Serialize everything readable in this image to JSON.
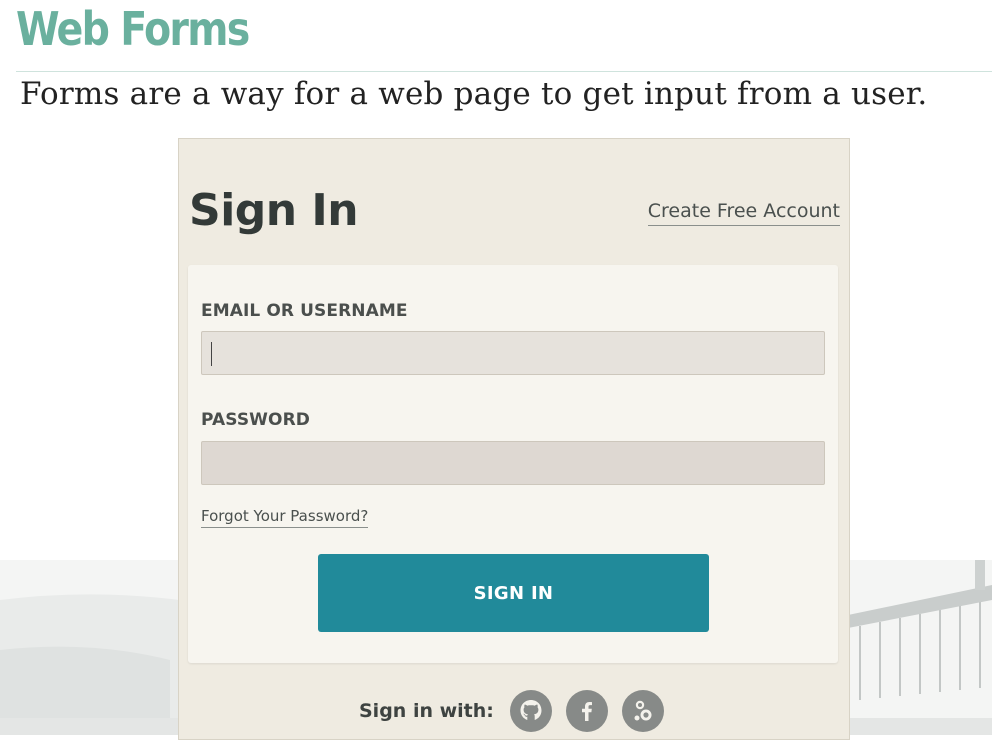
{
  "slide": {
    "title": "Web Forms",
    "subtitle": "Forms are a way for a web page to get input from a user."
  },
  "sign_in_card": {
    "heading": "Sign In",
    "create_account_link": "Create Free Account",
    "email_label": "EMAIL OR USERNAME",
    "email_value": "",
    "password_label": "PASSWORD",
    "password_value": "",
    "forgot_password_link": "Forgot Your Password?",
    "submit_label": "SIGN IN",
    "social_label": "Sign in with:",
    "social_icons": [
      "github-icon",
      "facebook-icon",
      "google-plus-icon"
    ]
  },
  "colors": {
    "title": "#6ab09e",
    "card_background": "#efebe1",
    "panel_background": "#f7f5ef",
    "button": "#218a9a",
    "social_icon": "#878a88"
  }
}
